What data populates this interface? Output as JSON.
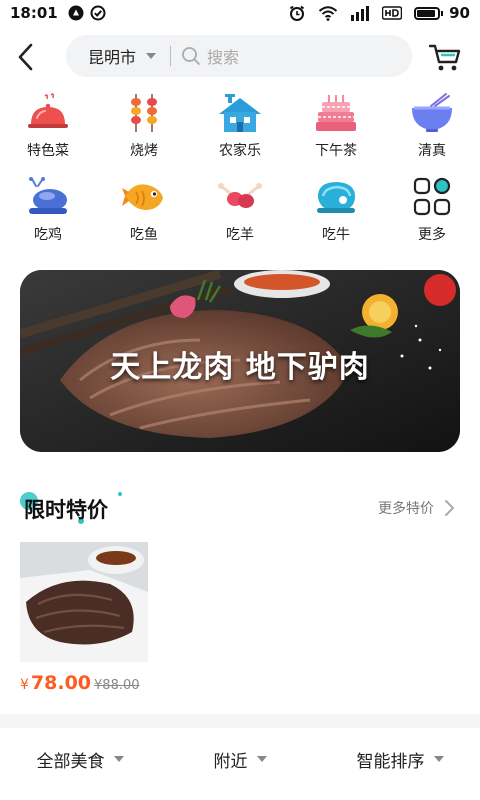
{
  "status_bar": {
    "time": "18:01",
    "battery": "90",
    "battery_level": 0.9
  },
  "header": {
    "city": "昆明市",
    "search_placeholder": "搜索"
  },
  "categories": [
    {
      "label": "特色菜",
      "icon": "cloche-icon"
    },
    {
      "label": "烧烤",
      "icon": "skewer-icon"
    },
    {
      "label": "农家乐",
      "icon": "farmhouse-icon"
    },
    {
      "label": "下午茶",
      "icon": "cake-icon"
    },
    {
      "label": "清真",
      "icon": "bowl-icon"
    },
    {
      "label": "吃鸡",
      "icon": "chicken-icon"
    },
    {
      "label": "吃鱼",
      "icon": "fish-icon"
    },
    {
      "label": "吃羊",
      "icon": "lamb-chop-icon"
    },
    {
      "label": "吃牛",
      "icon": "steak-icon"
    },
    {
      "label": "更多",
      "icon": "grid-more-icon"
    }
  ],
  "banner": {
    "text": "天上龙肉 地下驴肉"
  },
  "flash_sale": {
    "title": "限时特价",
    "more_label": "更多特价",
    "product": {
      "currency": "¥",
      "price": "78.00",
      "original_price": "¥88.00"
    }
  },
  "filters": {
    "all_food": "全部美食",
    "nearby": "附近",
    "sort": "智能排序"
  },
  "colors": {
    "accent": "#ff5a1f",
    "search_bg": "#f2f3f5",
    "teal_deco": "#2ec4c4"
  }
}
